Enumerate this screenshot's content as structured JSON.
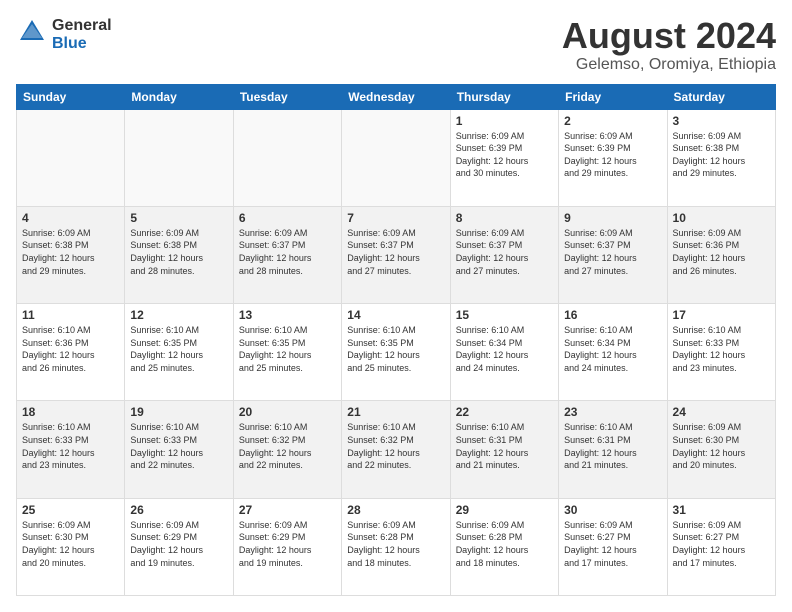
{
  "header": {
    "logo": {
      "line1": "General",
      "line2": "Blue"
    },
    "title": "August 2024",
    "location": "Gelemso, Oromiya, Ethiopia"
  },
  "days_of_week": [
    "Sunday",
    "Monday",
    "Tuesday",
    "Wednesday",
    "Thursday",
    "Friday",
    "Saturday"
  ],
  "weeks": [
    {
      "days": [
        {
          "num": "",
          "info": ""
        },
        {
          "num": "",
          "info": ""
        },
        {
          "num": "",
          "info": ""
        },
        {
          "num": "",
          "info": ""
        },
        {
          "num": "1",
          "info": "Sunrise: 6:09 AM\nSunset: 6:39 PM\nDaylight: 12 hours\nand 30 minutes."
        },
        {
          "num": "2",
          "info": "Sunrise: 6:09 AM\nSunset: 6:39 PM\nDaylight: 12 hours\nand 29 minutes."
        },
        {
          "num": "3",
          "info": "Sunrise: 6:09 AM\nSunset: 6:38 PM\nDaylight: 12 hours\nand 29 minutes."
        }
      ]
    },
    {
      "days": [
        {
          "num": "4",
          "info": "Sunrise: 6:09 AM\nSunset: 6:38 PM\nDaylight: 12 hours\nand 29 minutes."
        },
        {
          "num": "5",
          "info": "Sunrise: 6:09 AM\nSunset: 6:38 PM\nDaylight: 12 hours\nand 28 minutes."
        },
        {
          "num": "6",
          "info": "Sunrise: 6:09 AM\nSunset: 6:37 PM\nDaylight: 12 hours\nand 28 minutes."
        },
        {
          "num": "7",
          "info": "Sunrise: 6:09 AM\nSunset: 6:37 PM\nDaylight: 12 hours\nand 27 minutes."
        },
        {
          "num": "8",
          "info": "Sunrise: 6:09 AM\nSunset: 6:37 PM\nDaylight: 12 hours\nand 27 minutes."
        },
        {
          "num": "9",
          "info": "Sunrise: 6:09 AM\nSunset: 6:37 PM\nDaylight: 12 hours\nand 27 minutes."
        },
        {
          "num": "10",
          "info": "Sunrise: 6:09 AM\nSunset: 6:36 PM\nDaylight: 12 hours\nand 26 minutes."
        }
      ]
    },
    {
      "days": [
        {
          "num": "11",
          "info": "Sunrise: 6:10 AM\nSunset: 6:36 PM\nDaylight: 12 hours\nand 26 minutes."
        },
        {
          "num": "12",
          "info": "Sunrise: 6:10 AM\nSunset: 6:35 PM\nDaylight: 12 hours\nand 25 minutes."
        },
        {
          "num": "13",
          "info": "Sunrise: 6:10 AM\nSunset: 6:35 PM\nDaylight: 12 hours\nand 25 minutes."
        },
        {
          "num": "14",
          "info": "Sunrise: 6:10 AM\nSunset: 6:35 PM\nDaylight: 12 hours\nand 25 minutes."
        },
        {
          "num": "15",
          "info": "Sunrise: 6:10 AM\nSunset: 6:34 PM\nDaylight: 12 hours\nand 24 minutes."
        },
        {
          "num": "16",
          "info": "Sunrise: 6:10 AM\nSunset: 6:34 PM\nDaylight: 12 hours\nand 24 minutes."
        },
        {
          "num": "17",
          "info": "Sunrise: 6:10 AM\nSunset: 6:33 PM\nDaylight: 12 hours\nand 23 minutes."
        }
      ]
    },
    {
      "days": [
        {
          "num": "18",
          "info": "Sunrise: 6:10 AM\nSunset: 6:33 PM\nDaylight: 12 hours\nand 23 minutes."
        },
        {
          "num": "19",
          "info": "Sunrise: 6:10 AM\nSunset: 6:33 PM\nDaylight: 12 hours\nand 22 minutes."
        },
        {
          "num": "20",
          "info": "Sunrise: 6:10 AM\nSunset: 6:32 PM\nDaylight: 12 hours\nand 22 minutes."
        },
        {
          "num": "21",
          "info": "Sunrise: 6:10 AM\nSunset: 6:32 PM\nDaylight: 12 hours\nand 22 minutes."
        },
        {
          "num": "22",
          "info": "Sunrise: 6:10 AM\nSunset: 6:31 PM\nDaylight: 12 hours\nand 21 minutes."
        },
        {
          "num": "23",
          "info": "Sunrise: 6:10 AM\nSunset: 6:31 PM\nDaylight: 12 hours\nand 21 minutes."
        },
        {
          "num": "24",
          "info": "Sunrise: 6:09 AM\nSunset: 6:30 PM\nDaylight: 12 hours\nand 20 minutes."
        }
      ]
    },
    {
      "days": [
        {
          "num": "25",
          "info": "Sunrise: 6:09 AM\nSunset: 6:30 PM\nDaylight: 12 hours\nand 20 minutes."
        },
        {
          "num": "26",
          "info": "Sunrise: 6:09 AM\nSunset: 6:29 PM\nDaylight: 12 hours\nand 19 minutes."
        },
        {
          "num": "27",
          "info": "Sunrise: 6:09 AM\nSunset: 6:29 PM\nDaylight: 12 hours\nand 19 minutes."
        },
        {
          "num": "28",
          "info": "Sunrise: 6:09 AM\nSunset: 6:28 PM\nDaylight: 12 hours\nand 18 minutes."
        },
        {
          "num": "29",
          "info": "Sunrise: 6:09 AM\nSunset: 6:28 PM\nDaylight: 12 hours\nand 18 minutes."
        },
        {
          "num": "30",
          "info": "Sunrise: 6:09 AM\nSunset: 6:27 PM\nDaylight: 12 hours\nand 17 minutes."
        },
        {
          "num": "31",
          "info": "Sunrise: 6:09 AM\nSunset: 6:27 PM\nDaylight: 12 hours\nand 17 minutes."
        }
      ]
    }
  ]
}
